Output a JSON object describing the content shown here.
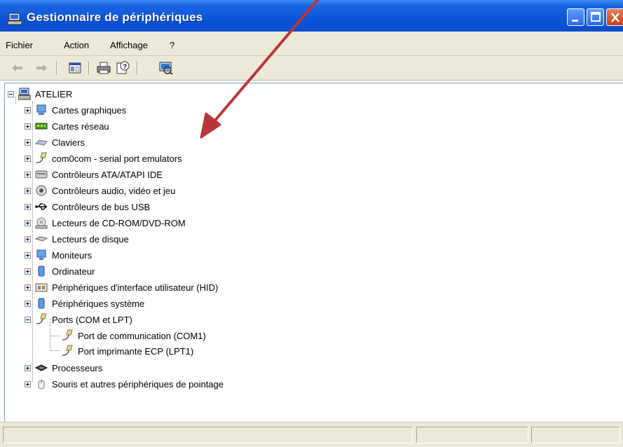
{
  "window": {
    "title": "Gestionnaire de périphériques"
  },
  "menu": {
    "items": [
      "Fichier",
      "Action",
      "Affichage",
      "?"
    ]
  },
  "toolbar": {
    "buttons": [
      "back-arrow",
      "forward-arrow",
      "properties-pane",
      "print",
      "help-properties",
      "scan-hardware"
    ]
  },
  "tree": {
    "root": "ATELIER",
    "items": [
      {
        "label": "Cartes graphiques",
        "icon": "display-adapter-icon",
        "expanded": false
      },
      {
        "label": "Cartes réseau",
        "icon": "network-card-icon",
        "expanded": false
      },
      {
        "label": "Claviers",
        "icon": "keyboard-icon",
        "expanded": false
      },
      {
        "label": "com0com - serial port emulators",
        "icon": "port-connector-icon",
        "expanded": false
      },
      {
        "label": "Contrôleurs ATA/ATAPI IDE",
        "icon": "ide-controller-icon",
        "expanded": false
      },
      {
        "label": "Contrôleurs audio, vidéo et jeu",
        "icon": "audio-icon",
        "expanded": false
      },
      {
        "label": "Contrôleurs de bus USB",
        "icon": "usb-icon",
        "expanded": false
      },
      {
        "label": "Lecteurs de CD-ROM/DVD-ROM",
        "icon": "cdrom-icon",
        "expanded": false
      },
      {
        "label": "Lecteurs de disque",
        "icon": "disk-drive-icon",
        "expanded": false
      },
      {
        "label": "Moniteurs",
        "icon": "monitor-icon",
        "expanded": false
      },
      {
        "label": "Ordinateur",
        "icon": "computer-icon",
        "expanded": false
      },
      {
        "label": "Périphériques d'interface utilisateur (HID)",
        "icon": "hid-icon",
        "expanded": false
      },
      {
        "label": "Périphériques système",
        "icon": "system-device-icon",
        "expanded": false
      },
      {
        "label": "Ports (COM et LPT)",
        "icon": "port-connector-icon",
        "expanded": true,
        "children": [
          {
            "label": "Port de communication (COM1)",
            "icon": "port-connector-icon"
          },
          {
            "label": "Port imprimante ECP (LPT1)",
            "icon": "port-connector-icon"
          }
        ]
      },
      {
        "label": "Processeurs",
        "icon": "processor-icon",
        "expanded": false
      },
      {
        "label": "Souris et autres périphériques de pointage",
        "icon": "mouse-icon",
        "expanded": false
      }
    ]
  },
  "colors": {
    "titlebar": "#0c54d8",
    "chrome": "#ece9d8",
    "annotation_arrow": "#b8363a"
  }
}
